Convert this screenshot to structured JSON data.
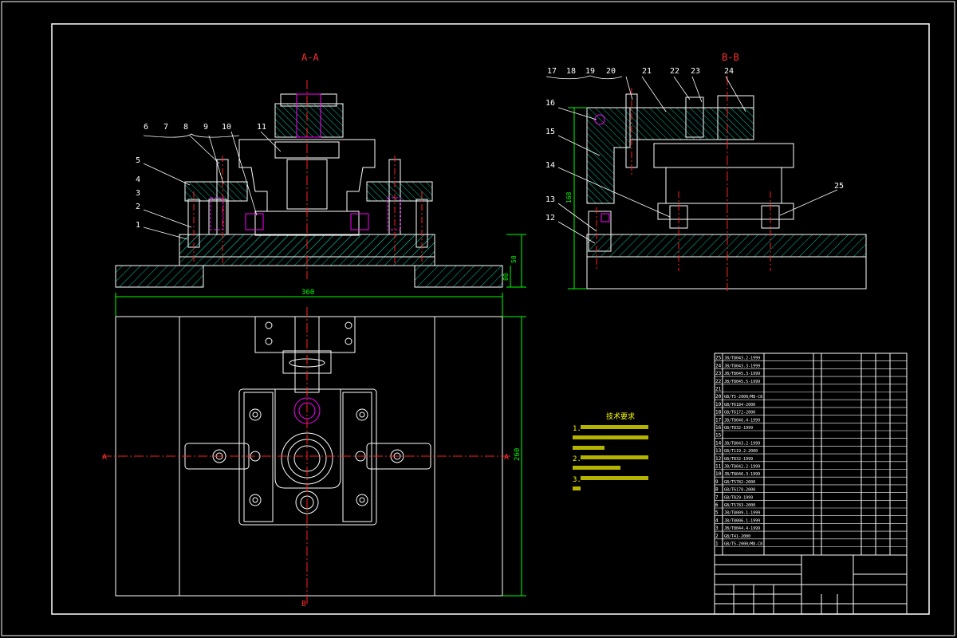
{
  "views": {
    "section_aa": "A-A",
    "section_bb": "B-B",
    "cut_a_left": "A",
    "cut_a_right": "A",
    "cut_b_bottom": "B"
  },
  "callouts_aa": [
    "1",
    "2",
    "3",
    "4",
    "5",
    "6",
    "7",
    "8",
    "9",
    "10",
    "11"
  ],
  "callouts_bb": [
    "12",
    "13",
    "14",
    "15",
    "16",
    "17",
    "18",
    "19",
    "20",
    "21",
    "22",
    "23",
    "24",
    "25"
  ],
  "dimensions": {
    "width": "360",
    "depth": "260",
    "height_aa_1": "50",
    "height_aa_2": "80",
    "height_bb": "168"
  },
  "notes": {
    "title": "技术要求",
    "lines": [
      "1.",
      "2.",
      "3."
    ]
  },
  "bom": {
    "rows": [
      {
        "no": "25",
        "std": "JB/T8043.2-1999"
      },
      {
        "no": "24",
        "std": "JB/T8043.3-1999"
      },
      {
        "no": "23",
        "std": "JB/T8045.3-1999"
      },
      {
        "no": "22",
        "std": "JB/T8045.5-1999"
      },
      {
        "no": "21",
        "std": ""
      },
      {
        "no": "20",
        "std": "GB/T5-2000/M8-C8"
      },
      {
        "no": "19",
        "std": "GB/T6184-2000"
      },
      {
        "no": "18",
        "std": "GB/T6172-2000"
      },
      {
        "no": "17",
        "std": "JB/T8046.4-1999"
      },
      {
        "no": "16",
        "std": "GB/T832-1999"
      },
      {
        "no": "15",
        "std": ""
      },
      {
        "no": "14",
        "std": "JB/T8043.2-1999"
      },
      {
        "no": "13",
        "std": "GB/T119.2-2000"
      },
      {
        "no": "12",
        "std": "GB/T832-1999"
      },
      {
        "no": "11",
        "std": "JB/T8042.2-1999"
      },
      {
        "no": "10",
        "std": "JB/T8046.3-1999"
      },
      {
        "no": "9",
        "std": "GB/T5782-2000"
      },
      {
        "no": "8",
        "std": "GB/T6170-2000"
      },
      {
        "no": "7",
        "std": "GB/T829-1999"
      },
      {
        "no": "6",
        "std": "GB/T5783-2000"
      },
      {
        "no": "5",
        "std": "JB/T8009.1-1999"
      },
      {
        "no": "4",
        "std": "JB/T8006.1-1999"
      },
      {
        "no": "3",
        "std": "JB/T8044.4-1999"
      },
      {
        "no": "2",
        "std": "GB/T41-2000"
      },
      {
        "no": "1",
        "std": "GB/T5-2000/M8-C8"
      }
    ]
  },
  "colors": {
    "frame": "#ffffff",
    "outline": "#ffffff",
    "hatch": "#00c0a0",
    "center": "#ff2020",
    "dim": "#00ff00",
    "part": "#ff00ff",
    "view_label": "#ff3030",
    "notes": "#ffff00"
  }
}
